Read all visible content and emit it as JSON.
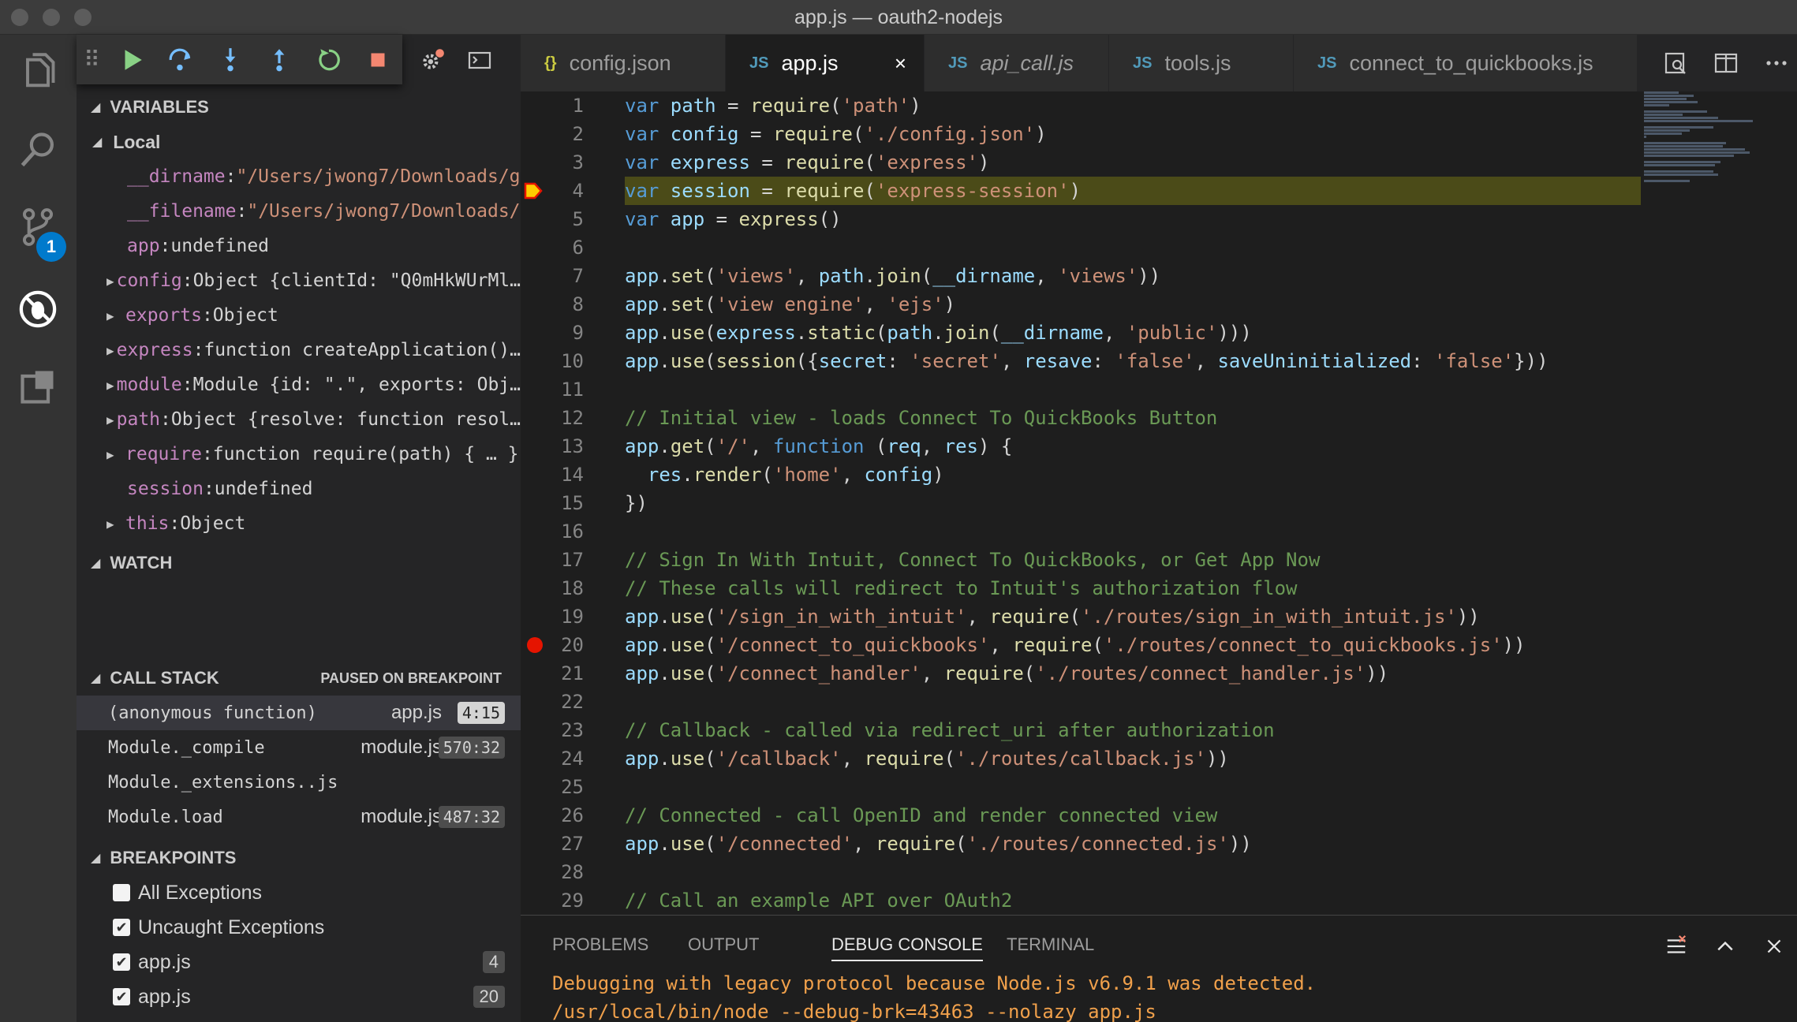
{
  "window": {
    "title": "app.js — oauth2-nodejs"
  },
  "activity": {
    "scm_badge": "1"
  },
  "sections": {
    "variables": "VARIABLES",
    "local": "Local",
    "watch": "WATCH",
    "call_stack": "CALL STACK",
    "call_stack_status": "PAUSED ON BREAKPOINT",
    "breakpoints": "BREAKPOINTS"
  },
  "variables": [
    {
      "name": "__dirname",
      "value": "\"/Users/jwong7/Downloads/g…",
      "kind": "str",
      "expandable": false
    },
    {
      "name": "__filename",
      "value": "\"/Users/jwong7/Downloads/…",
      "kind": "str",
      "expandable": false
    },
    {
      "name": "app",
      "value": "undefined",
      "kind": "plain",
      "expandable": false
    },
    {
      "name": "config",
      "value": "Object {clientId: \"Q0mHkWUrMl…",
      "kind": "plain",
      "expandable": true
    },
    {
      "name": "exports",
      "value": "Object",
      "kind": "plain",
      "expandable": true
    },
    {
      "name": "express",
      "value": "function createApplication()…",
      "kind": "plain",
      "expandable": true
    },
    {
      "name": "module",
      "value": "Module {id: \".\", exports: Obj…",
      "kind": "plain",
      "expandable": true
    },
    {
      "name": "path",
      "value": "Object {resolve: function resol…",
      "kind": "plain",
      "expandable": true
    },
    {
      "name": "require",
      "value": "function require(path) { … }",
      "kind": "plain",
      "expandable": true
    },
    {
      "name": "session",
      "value": "undefined",
      "kind": "plain",
      "expandable": false
    },
    {
      "name": "this",
      "value": "Object",
      "kind": "plain",
      "expandable": true
    }
  ],
  "call_stack": [
    {
      "fn": "(anonymous function)",
      "file": "app.js",
      "pos": "4:15",
      "active": true
    },
    {
      "fn": "Module._compile",
      "file": "module.js",
      "pos": "570:32",
      "active": false
    },
    {
      "fn": "Module._extensions..js",
      "file": "",
      "pos": "",
      "active": false
    },
    {
      "fn": "Module.load",
      "file": "module.js",
      "pos": "487:32",
      "active": false
    }
  ],
  "breakpoints": [
    {
      "label": "All Exceptions",
      "checked": false,
      "line": ""
    },
    {
      "label": "Uncaught Exceptions",
      "checked": true,
      "line": ""
    },
    {
      "label": "app.js",
      "checked": true,
      "line": "4"
    },
    {
      "label": "app.js",
      "checked": true,
      "line": "20"
    }
  ],
  "tabs": [
    {
      "label": "config.json",
      "icon": "{}",
      "type": "json",
      "active": false,
      "italic": false
    },
    {
      "label": "app.js",
      "icon": "JS",
      "type": "js",
      "active": true,
      "italic": false
    },
    {
      "label": "api_call.js",
      "icon": "JS",
      "type": "js",
      "active": false,
      "italic": true
    },
    {
      "label": "tools.js",
      "icon": "JS",
      "type": "js",
      "active": false,
      "italic": false
    },
    {
      "label": "connect_to_quickbooks.js",
      "icon": "JS",
      "type": "js",
      "active": false,
      "italic": false
    }
  ],
  "editor": {
    "current_line": 4,
    "breakpoint_lines": [
      20
    ],
    "lines": [
      [
        [
          "k",
          "var "
        ],
        [
          "v",
          "path"
        ],
        [
          "p",
          " = "
        ],
        [
          "f",
          "require"
        ],
        [
          "p",
          "("
        ],
        [
          "s",
          "'path'"
        ],
        [
          "p",
          ")"
        ]
      ],
      [
        [
          "k",
          "var "
        ],
        [
          "v",
          "config"
        ],
        [
          "p",
          " = "
        ],
        [
          "f",
          "require"
        ],
        [
          "p",
          "("
        ],
        [
          "s",
          "'./config.json'"
        ],
        [
          "p",
          ")"
        ]
      ],
      [
        [
          "k",
          "var "
        ],
        [
          "v",
          "express"
        ],
        [
          "p",
          " = "
        ],
        [
          "f",
          "require"
        ],
        [
          "p",
          "("
        ],
        [
          "s",
          "'express'"
        ],
        [
          "p",
          ")"
        ]
      ],
      [
        [
          "k",
          "var "
        ],
        [
          "v",
          "session"
        ],
        [
          "p",
          " = "
        ],
        [
          "f",
          "require"
        ],
        [
          "p",
          "("
        ],
        [
          "s",
          "'express-session'"
        ],
        [
          "p",
          ")"
        ]
      ],
      [
        [
          "k",
          "var "
        ],
        [
          "v",
          "app"
        ],
        [
          "p",
          " = "
        ],
        [
          "f",
          "express"
        ],
        [
          "p",
          "()"
        ]
      ],
      [],
      [
        [
          "v",
          "app"
        ],
        [
          "p",
          "."
        ],
        [
          "f",
          "set"
        ],
        [
          "p",
          "("
        ],
        [
          "s",
          "'views'"
        ],
        [
          "p",
          ", "
        ],
        [
          "v",
          "path"
        ],
        [
          "p",
          "."
        ],
        [
          "f",
          "join"
        ],
        [
          "p",
          "("
        ],
        [
          "v",
          "__dirname"
        ],
        [
          "p",
          ", "
        ],
        [
          "s",
          "'views'"
        ],
        [
          "p",
          "))"
        ]
      ],
      [
        [
          "v",
          "app"
        ],
        [
          "p",
          "."
        ],
        [
          "f",
          "set"
        ],
        [
          "p",
          "("
        ],
        [
          "s",
          "'view engine'"
        ],
        [
          "p",
          ", "
        ],
        [
          "s",
          "'ejs'"
        ],
        [
          "p",
          ")"
        ]
      ],
      [
        [
          "v",
          "app"
        ],
        [
          "p",
          "."
        ],
        [
          "f",
          "use"
        ],
        [
          "p",
          "("
        ],
        [
          "v",
          "express"
        ],
        [
          "p",
          "."
        ],
        [
          "f",
          "static"
        ],
        [
          "p",
          "("
        ],
        [
          "v",
          "path"
        ],
        [
          "p",
          "."
        ],
        [
          "f",
          "join"
        ],
        [
          "p",
          "("
        ],
        [
          "v",
          "__dirname"
        ],
        [
          "p",
          ", "
        ],
        [
          "s",
          "'public'"
        ],
        [
          "p",
          ")))"
        ]
      ],
      [
        [
          "v",
          "app"
        ],
        [
          "p",
          "."
        ],
        [
          "f",
          "use"
        ],
        [
          "p",
          "("
        ],
        [
          "f",
          "session"
        ],
        [
          "p",
          "({"
        ],
        [
          "v",
          "secret"
        ],
        [
          "p",
          ": "
        ],
        [
          "s",
          "'secret'"
        ],
        [
          "p",
          ", "
        ],
        [
          "v",
          "resave"
        ],
        [
          "p",
          ": "
        ],
        [
          "s",
          "'false'"
        ],
        [
          "p",
          ", "
        ],
        [
          "v",
          "saveUninitialized"
        ],
        [
          "p",
          ": "
        ],
        [
          "s",
          "'false'"
        ],
        [
          "p",
          "}))"
        ]
      ],
      [],
      [
        [
          "c",
          "// Initial view - loads Connect To QuickBooks Button"
        ]
      ],
      [
        [
          "v",
          "app"
        ],
        [
          "p",
          "."
        ],
        [
          "f",
          "get"
        ],
        [
          "p",
          "("
        ],
        [
          "s",
          "'/'"
        ],
        [
          "p",
          ", "
        ],
        [
          "k",
          "function"
        ],
        [
          "p",
          " ("
        ],
        [
          "v",
          "req"
        ],
        [
          "p",
          ", "
        ],
        [
          "v",
          "res"
        ],
        [
          "p",
          ") {"
        ]
      ],
      [
        [
          "p",
          "  "
        ],
        [
          "v",
          "res"
        ],
        [
          "p",
          "."
        ],
        [
          "f",
          "render"
        ],
        [
          "p",
          "("
        ],
        [
          "s",
          "'home'"
        ],
        [
          "p",
          ", "
        ],
        [
          "v",
          "config"
        ],
        [
          "p",
          ")"
        ]
      ],
      [
        [
          "p",
          "})"
        ]
      ],
      [],
      [
        [
          "c",
          "// Sign In With Intuit, Connect To QuickBooks, or Get App Now"
        ]
      ],
      [
        [
          "c",
          "// These calls will redirect to Intuit's authorization flow"
        ]
      ],
      [
        [
          "v",
          "app"
        ],
        [
          "p",
          "."
        ],
        [
          "f",
          "use"
        ],
        [
          "p",
          "("
        ],
        [
          "s",
          "'/sign_in_with_intuit'"
        ],
        [
          "p",
          ", "
        ],
        [
          "f",
          "require"
        ],
        [
          "p",
          "("
        ],
        [
          "s",
          "'./routes/sign_in_with_intuit.js'"
        ],
        [
          "p",
          "))"
        ]
      ],
      [
        [
          "v",
          "app"
        ],
        [
          "p",
          "."
        ],
        [
          "f",
          "use"
        ],
        [
          "p",
          "("
        ],
        [
          "s",
          "'/connect_to_quickbooks'"
        ],
        [
          "p",
          ", "
        ],
        [
          "f",
          "require"
        ],
        [
          "p",
          "("
        ],
        [
          "s",
          "'./routes/connect_to_quickbooks.js'"
        ],
        [
          "p",
          "))"
        ]
      ],
      [
        [
          "v",
          "app"
        ],
        [
          "p",
          "."
        ],
        [
          "f",
          "use"
        ],
        [
          "p",
          "("
        ],
        [
          "s",
          "'/connect_handler'"
        ],
        [
          "p",
          ", "
        ],
        [
          "f",
          "require"
        ],
        [
          "p",
          "("
        ],
        [
          "s",
          "'./routes/connect_handler.js'"
        ],
        [
          "p",
          "))"
        ]
      ],
      [],
      [
        [
          "c",
          "// Callback - called via redirect_uri after authorization"
        ]
      ],
      [
        [
          "v",
          "app"
        ],
        [
          "p",
          "."
        ],
        [
          "f",
          "use"
        ],
        [
          "p",
          "("
        ],
        [
          "s",
          "'/callback'"
        ],
        [
          "p",
          ", "
        ],
        [
          "f",
          "require"
        ],
        [
          "p",
          "("
        ],
        [
          "s",
          "'./routes/callback.js'"
        ],
        [
          "p",
          "))"
        ]
      ],
      [],
      [
        [
          "c",
          "// Connected - call OpenID and render connected view"
        ]
      ],
      [
        [
          "v",
          "app"
        ],
        [
          "p",
          "."
        ],
        [
          "f",
          "use"
        ],
        [
          "p",
          "("
        ],
        [
          "s",
          "'/connected'"
        ],
        [
          "p",
          ", "
        ],
        [
          "f",
          "require"
        ],
        [
          "p",
          "("
        ],
        [
          "s",
          "'./routes/connected.js'"
        ],
        [
          "p",
          "))"
        ]
      ],
      [],
      [
        [
          "c",
          "// Call an example API over OAuth2"
        ]
      ]
    ]
  },
  "panel": {
    "tabs": [
      "PROBLEMS",
      "OUTPUT",
      "DEBUG CONSOLE",
      "TERMINAL"
    ],
    "active_tab": "DEBUG CONSOLE",
    "output": [
      "Debugging with legacy protocol because Node.js v6.9.1 was detected.",
      "/usr/local/bin/node --debug-brk=43463 --nolazy app.js"
    ]
  },
  "colors": {
    "accent": "#007acc",
    "breakpoint": "#e51400",
    "current_line": "#4b4b18",
    "console_text": "#f0a04b"
  }
}
